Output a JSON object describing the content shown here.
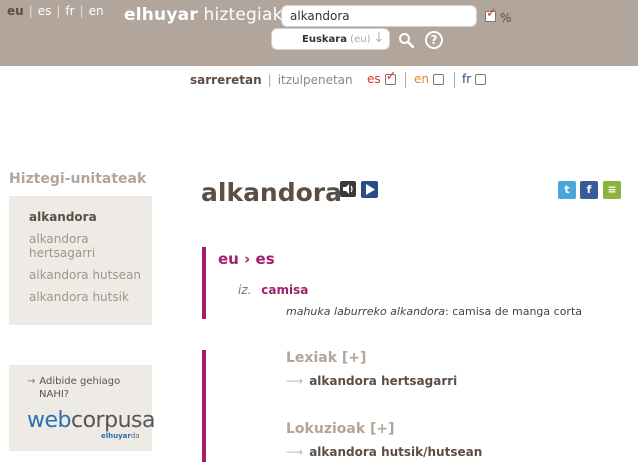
{
  "header": {
    "languages": [
      "eu",
      "es",
      "fr",
      "en"
    ],
    "active_language": "eu",
    "brand_bold": "elhuyar",
    "brand_rest": "hiztegiak",
    "search_value": "alkandora",
    "percent_label": "%",
    "direction_main": "Euskara",
    "direction_sub": "(eu)",
    "direction_arrow": "↓",
    "help_label": "?"
  },
  "modes": {
    "active": "sarreretan",
    "other": "itzulpenetan"
  },
  "target_filters": [
    {
      "code": "es",
      "checked": true,
      "color": "#d9342b"
    },
    {
      "code": "en",
      "checked": false,
      "color": "#e08a1e"
    },
    {
      "code": "fr",
      "checked": false,
      "color": "#2a4e82"
    }
  ],
  "sidebar": {
    "title": "Hiztegi-unitateak",
    "units": [
      "alkandora",
      "alkandora hertsagarri",
      "alkandora hutsean",
      "alkandora hutsik"
    ],
    "corpus_line1": "Adibide gehiago",
    "corpus_line2": "NAHI?",
    "corpus_logo_web": "web",
    "corpus_logo_corpus": "corpusa",
    "corpus_sub_bold": "elhuyar",
    "corpus_sub_rest": "da"
  },
  "entry": {
    "headword": "alkandora",
    "share_icons": [
      "twitter-icon",
      "facebook-icon",
      "notes-icon"
    ],
    "direction_from": "eu",
    "direction_arrow": "›",
    "direction_to": "es",
    "category": "iz.",
    "translation": "camisa",
    "example_source": "mahuka laburreko alkandora",
    "example_target": ": camisa de manga corta",
    "lexiak_title": "Lexiak [+]",
    "lexiak_item": "alkandora hertsagarri",
    "lokuzioak_title": "Lokuzioak [+]",
    "lokuzioak_item": "alkandora hutsik/hutsean",
    "item_arrow": "⟶"
  },
  "colors": {
    "header_bg": "#b2a59b",
    "accent": "#a11f6d",
    "muted": "#b2a59b"
  }
}
